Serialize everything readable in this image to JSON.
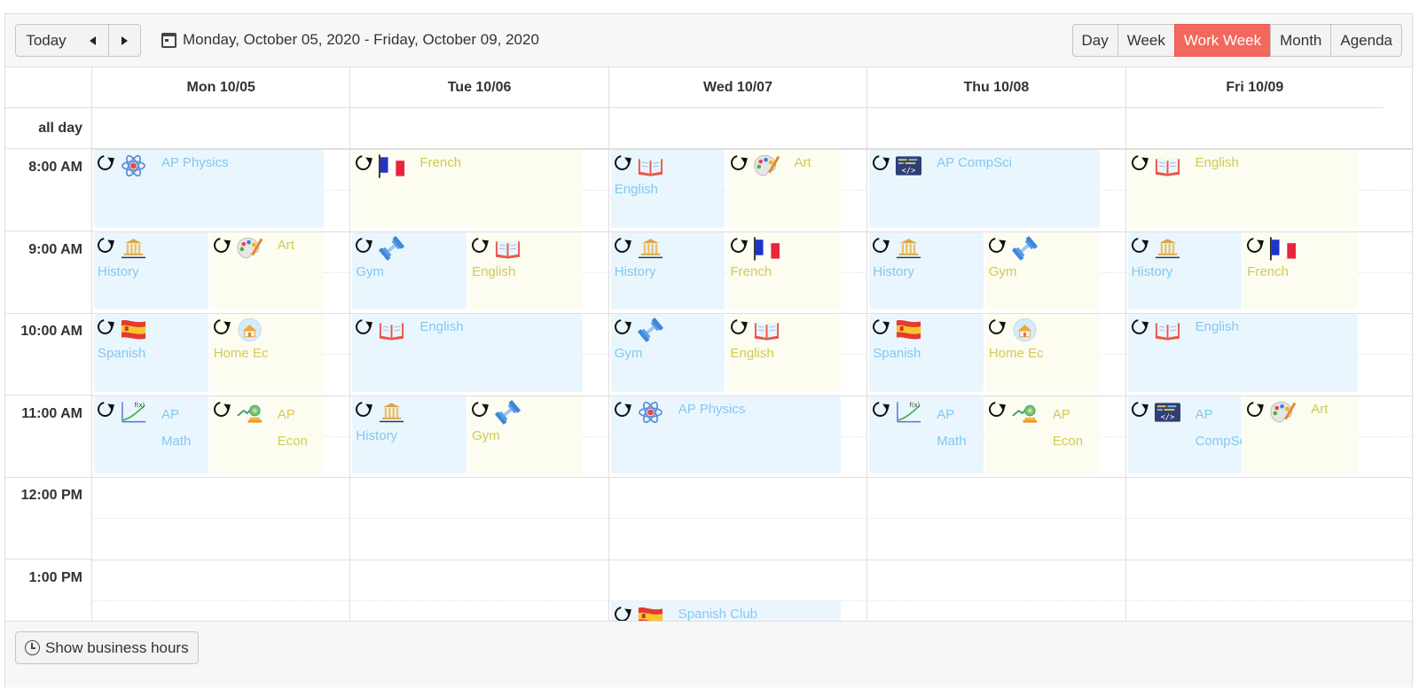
{
  "toolbar": {
    "today_label": "Today",
    "range_text": "Monday, October 05, 2020 - Friday, October 09, 2020",
    "views": [
      {
        "label": "Day",
        "active": false
      },
      {
        "label": "Week",
        "active": false
      },
      {
        "label": "Work Week",
        "active": true
      },
      {
        "label": "Month",
        "active": false
      },
      {
        "label": "Agenda",
        "active": false
      }
    ]
  },
  "days": [
    "Mon 10/05",
    "Tue 10/06",
    "Wed 10/07",
    "Thu 10/08",
    "Fri 10/09"
  ],
  "allday_label": "all day",
  "times": [
    "8:00 AM",
    "9:00 AM",
    "10:00 AM",
    "11:00 AM",
    "12:00 PM",
    "1:00 PM"
  ],
  "colors": {
    "accent": "#f2685d",
    "event_blue": "#eaf6fe",
    "event_yellow": "#fcfcf1",
    "text_blue": "#82c8ee",
    "text_yellow": "#d2ca55"
  },
  "events": [
    {
      "day": 0,
      "hour": 0,
      "lane": 0,
      "lanes": 1,
      "color": "blue",
      "icon": "atom-icon",
      "title": "AP Physics"
    },
    {
      "day": 1,
      "hour": 0,
      "lane": 0,
      "lanes": 1,
      "color": "yellow",
      "icon": "france-flag-icon",
      "title": "French"
    },
    {
      "day": 2,
      "hour": 0,
      "lane": 0,
      "lanes": 2,
      "color": "blue",
      "icon": "book-icon",
      "title": "English"
    },
    {
      "day": 2,
      "hour": 0,
      "lane": 1,
      "lanes": 2,
      "color": "yellow",
      "icon": "palette-icon",
      "title": "Art"
    },
    {
      "day": 3,
      "hour": 0,
      "lane": 0,
      "lanes": 1,
      "color": "blue",
      "icon": "code-icon",
      "title": "AP CompSci"
    },
    {
      "day": 4,
      "hour": 0,
      "lane": 0,
      "lanes": 1,
      "color": "yellow",
      "icon": "book-icon",
      "title": "English"
    },
    {
      "day": 0,
      "hour": 1,
      "lane": 0,
      "lanes": 2,
      "color": "blue",
      "icon": "museum-icon",
      "title": "History"
    },
    {
      "day": 0,
      "hour": 1,
      "lane": 1,
      "lanes": 2,
      "color": "yellow",
      "icon": "palette-icon",
      "title": "Art"
    },
    {
      "day": 1,
      "hour": 1,
      "lane": 0,
      "lanes": 2,
      "color": "blue",
      "icon": "dumbbell-icon",
      "title": "Gym"
    },
    {
      "day": 1,
      "hour": 1,
      "lane": 1,
      "lanes": 2,
      "color": "yellow",
      "icon": "book-icon",
      "title": "English"
    },
    {
      "day": 2,
      "hour": 1,
      "lane": 0,
      "lanes": 2,
      "color": "blue",
      "icon": "museum-icon",
      "title": "History"
    },
    {
      "day": 2,
      "hour": 1,
      "lane": 1,
      "lanes": 2,
      "color": "yellow",
      "icon": "france-flag-icon",
      "title": "French"
    },
    {
      "day": 3,
      "hour": 1,
      "lane": 0,
      "lanes": 2,
      "color": "blue",
      "icon": "museum-icon",
      "title": "History"
    },
    {
      "day": 3,
      "hour": 1,
      "lane": 1,
      "lanes": 2,
      "color": "yellow",
      "icon": "dumbbell-icon",
      "title": "Gym"
    },
    {
      "day": 4,
      "hour": 1,
      "lane": 0,
      "lanes": 2,
      "color": "blue",
      "icon": "museum-icon",
      "title": "History"
    },
    {
      "day": 4,
      "hour": 1,
      "lane": 1,
      "lanes": 2,
      "color": "yellow",
      "icon": "france-flag-icon",
      "title": "French"
    },
    {
      "day": 0,
      "hour": 2,
      "lane": 0,
      "lanes": 2,
      "color": "blue",
      "icon": "spain-flag-icon",
      "title": "Spanish"
    },
    {
      "day": 0,
      "hour": 2,
      "lane": 1,
      "lanes": 2,
      "color": "yellow",
      "icon": "home-icon",
      "title": "Home Ec"
    },
    {
      "day": 1,
      "hour": 2,
      "lane": 0,
      "lanes": 1,
      "color": "blue",
      "icon": "book-icon",
      "title": "English"
    },
    {
      "day": 2,
      "hour": 2,
      "lane": 0,
      "lanes": 2,
      "color": "blue",
      "icon": "dumbbell-icon",
      "title": "Gym"
    },
    {
      "day": 2,
      "hour": 2,
      "lane": 1,
      "lanes": 2,
      "color": "yellow",
      "icon": "book-icon",
      "title": "English"
    },
    {
      "day": 3,
      "hour": 2,
      "lane": 0,
      "lanes": 2,
      "color": "blue",
      "icon": "spain-flag-icon",
      "title": "Spanish"
    },
    {
      "day": 3,
      "hour": 2,
      "lane": 1,
      "lanes": 2,
      "color": "yellow",
      "icon": "home-icon",
      "title": "Home Ec"
    },
    {
      "day": 4,
      "hour": 2,
      "lane": 0,
      "lanes": 1,
      "color": "blue",
      "icon": "book-icon",
      "title": "English"
    },
    {
      "day": 0,
      "hour": 3,
      "lane": 0,
      "lanes": 2,
      "color": "blue",
      "icon": "chart-icon",
      "title": "AP Math"
    },
    {
      "day": 0,
      "hour": 3,
      "lane": 1,
      "lanes": 2,
      "color": "yellow",
      "icon": "growth-icon",
      "title": "AP Econ"
    },
    {
      "day": 1,
      "hour": 3,
      "lane": 0,
      "lanes": 2,
      "color": "blue",
      "icon": "museum-icon",
      "title": "History"
    },
    {
      "day": 1,
      "hour": 3,
      "lane": 1,
      "lanes": 2,
      "color": "yellow",
      "icon": "dumbbell-icon",
      "title": "Gym"
    },
    {
      "day": 2,
      "hour": 3,
      "lane": 0,
      "lanes": 1,
      "color": "blue",
      "icon": "atom-icon",
      "title": "AP Physics"
    },
    {
      "day": 3,
      "hour": 3,
      "lane": 0,
      "lanes": 2,
      "color": "blue",
      "icon": "chart-icon",
      "title": "AP Math"
    },
    {
      "day": 3,
      "hour": 3,
      "lane": 1,
      "lanes": 2,
      "color": "yellow",
      "icon": "growth-icon",
      "title": "AP Econ"
    },
    {
      "day": 4,
      "hour": 3,
      "lane": 0,
      "lanes": 2,
      "color": "blue",
      "icon": "code-icon",
      "title": "AP CompSci"
    },
    {
      "day": 4,
      "hour": 3,
      "lane": 1,
      "lanes": 2,
      "color": "yellow",
      "icon": "palette-icon",
      "title": "Art"
    },
    {
      "day": 2,
      "hour": 5.5,
      "lane": 0,
      "lanes": 1,
      "color": "blue",
      "icon": "spain-flag-icon",
      "title": "Spanish Club"
    }
  ],
  "footer": {
    "business_hours_label": "Show business hours"
  }
}
